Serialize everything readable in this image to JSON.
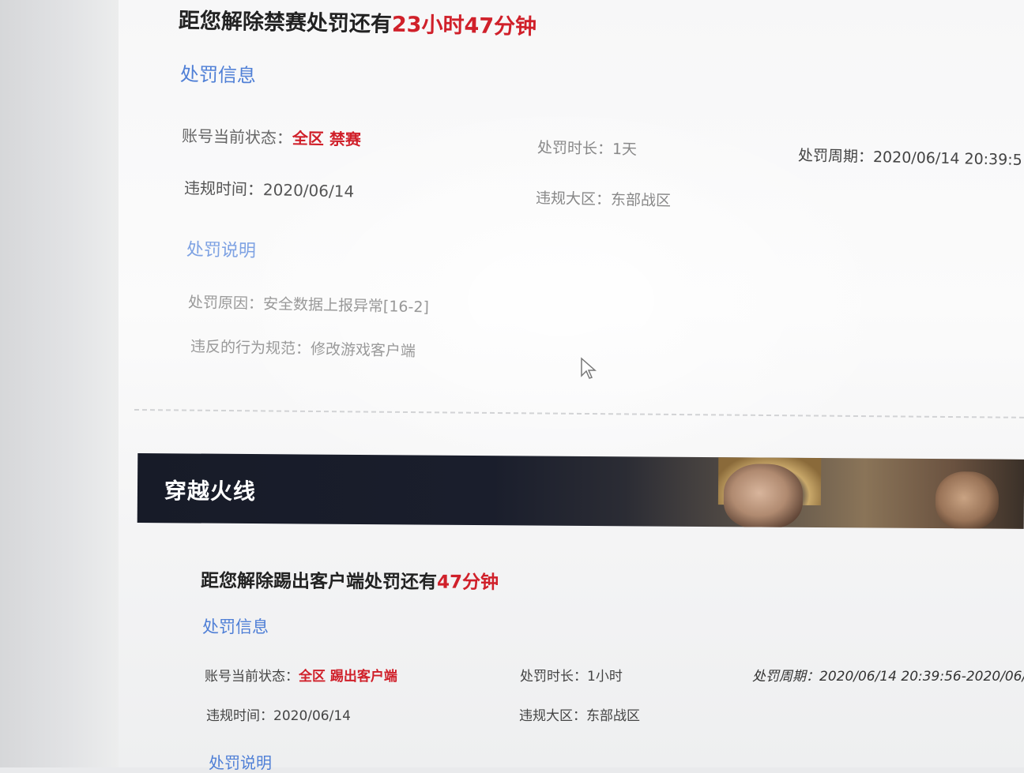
{
  "section1": {
    "title_prefix": "距您解除禁赛处罚还有",
    "title_time": "23小时47分钟",
    "info_header": "处罚信息",
    "status_label": "账号当前状态：",
    "status_value": "全区 禁赛",
    "duration_label": "处罚时长：",
    "duration_value": "1天",
    "period_label": "处罚周期：",
    "period_value": "2020/06/14 20:39:5",
    "time_label": "违规时间：",
    "time_value": "2020/06/14",
    "region_label": "违规大区：",
    "region_value": "东部战区",
    "explain_header": "处罚说明",
    "reason_label": "处罚原因：",
    "reason_value": "安全数据上报异常[16-2]",
    "violation_label": "违反的行为规范：",
    "violation_value": "修改游戏客户端"
  },
  "banner": {
    "game_title": "穿越火线"
  },
  "section2": {
    "title_prefix": "距您解除踢出客户端处罚还有",
    "title_time": "47分钟",
    "info_header": "处罚信息",
    "status_label": "账号当前状态：",
    "status_value": "全区 踢出客户端",
    "duration_label": "处罚时长：",
    "duration_value": "1小时",
    "period_label": "处罚周期：",
    "period_value": "2020/06/14 20:39:56-2020/06/",
    "time_label": "违规时间：",
    "time_value": "2020/06/14",
    "region_label": "违规大区：",
    "region_value": "东部战区",
    "explain_header": "处罚说明"
  },
  "colors": {
    "accent_red": "#d0202a",
    "link_blue": "#4f7fd6",
    "banner_dark": "#171b28"
  },
  "icons": {
    "cursor": "mouse-pointer-icon"
  }
}
